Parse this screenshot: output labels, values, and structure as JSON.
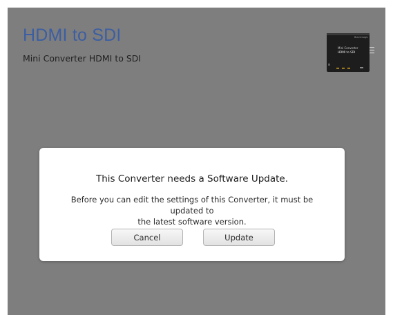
{
  "header": {
    "title": "HDMI to SDI",
    "subtitle": "Mini Converter HDMI to SDI"
  },
  "device_image": {
    "icon": "converter-device-icon",
    "label_line1": "Mini Converter",
    "label_line2": "HDMI to SDI"
  },
  "dialog": {
    "title": "This Converter needs a Software Update.",
    "message_line1": "Before you can edit the settings of this Converter, it must be updated to",
    "message_line2": "the latest software version.",
    "cancel_label": "Cancel",
    "update_label": "Update"
  },
  "colors": {
    "background": "#7e7e7e",
    "title": "#3c5ea2",
    "dialog": "#ffffff"
  }
}
